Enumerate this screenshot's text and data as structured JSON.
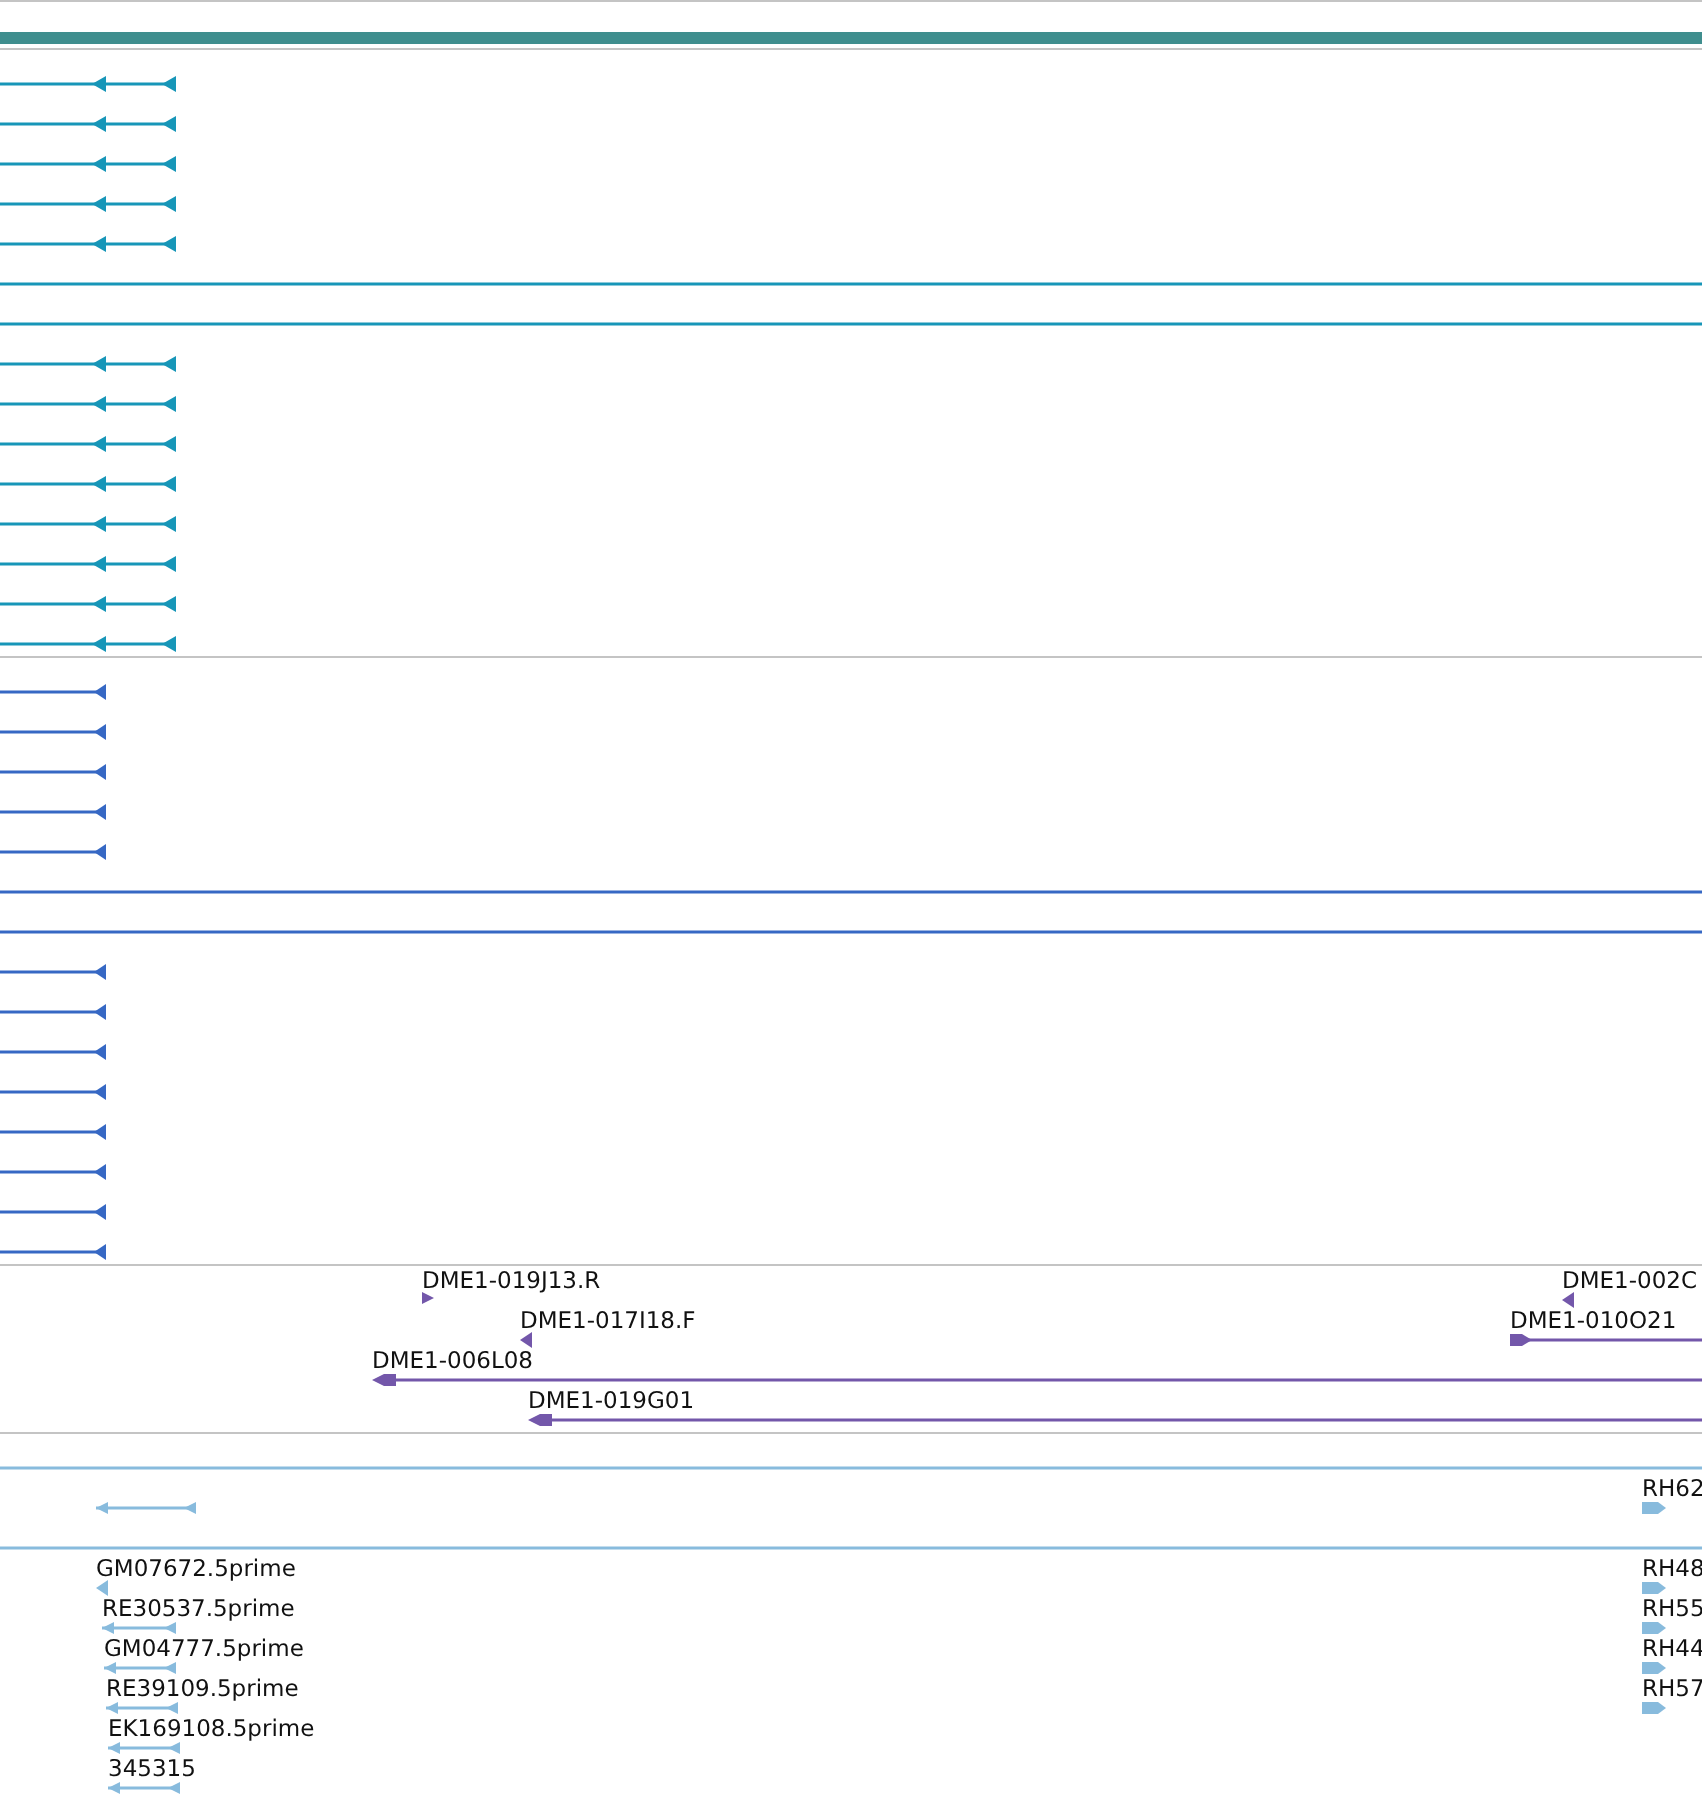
{
  "tracks": [
    {
      "color": "#1796b8",
      "rows": [
        {
          "features": [
            {
              "kind": "paired"
            }
          ]
        },
        {
          "features": [
            {
              "kind": "paired"
            }
          ]
        },
        {
          "features": [
            {
              "kind": "paired"
            }
          ]
        },
        {
          "features": [
            {
              "kind": "paired"
            }
          ]
        },
        {
          "features": [
            {
              "kind": "paired"
            }
          ]
        },
        {
          "features": [
            {
              "kind": "line"
            }
          ]
        },
        {
          "features": [
            {
              "kind": "line"
            }
          ]
        },
        {
          "features": [
            {
              "kind": "paired"
            }
          ]
        },
        {
          "features": [
            {
              "kind": "paired"
            }
          ]
        },
        {
          "features": [
            {
              "kind": "paired"
            }
          ]
        },
        {
          "features": [
            {
              "kind": "paired"
            }
          ]
        },
        {
          "features": [
            {
              "kind": "paired"
            }
          ]
        },
        {
          "features": [
            {
              "kind": "paired"
            }
          ]
        },
        {
          "features": [
            {
              "kind": "paired"
            }
          ]
        },
        {
          "features": [
            {
              "kind": "paired"
            }
          ]
        }
      ]
    },
    {
      "color": "#3668c4",
      "rows": [
        {
          "features": [
            {
              "kind": "single"
            }
          ]
        },
        {
          "features": [
            {
              "kind": "single"
            }
          ]
        },
        {
          "features": [
            {
              "kind": "single"
            }
          ]
        },
        {
          "features": [
            {
              "kind": "single"
            }
          ]
        },
        {
          "features": [
            {
              "kind": "single"
            }
          ]
        },
        {
          "features": [
            {
              "kind": "line"
            }
          ]
        },
        {
          "features": [
            {
              "kind": "line"
            }
          ]
        },
        {
          "features": [
            {
              "kind": "single"
            }
          ]
        },
        {
          "features": [
            {
              "kind": "single"
            }
          ]
        },
        {
          "features": [
            {
              "kind": "single"
            }
          ]
        },
        {
          "features": [
            {
              "kind": "single"
            }
          ]
        },
        {
          "features": [
            {
              "kind": "single"
            }
          ]
        },
        {
          "features": [
            {
              "kind": "single"
            }
          ]
        },
        {
          "features": [
            {
              "kind": "single"
            }
          ]
        },
        {
          "features": [
            {
              "kind": "single"
            }
          ]
        }
      ]
    },
    {
      "color": "#7357aa",
      "rows": [
        {
          "features": [
            {
              "label": "DME1-019J13.R",
              "kind": "tickright"
            },
            {
              "label": "DME1-002C",
              "kind": "tickleft"
            }
          ]
        },
        {
          "features": [
            {
              "label": "DME1-017I18.F",
              "kind": "tickleft"
            },
            {
              "label": "DME1-010O21",
              "kind": "longright"
            }
          ]
        },
        {
          "features": [
            {
              "label": "DME1-006L08",
              "kind": "longleft"
            }
          ]
        },
        {
          "features": [
            {
              "label": "DME1-019G01",
              "kind": "longleft"
            }
          ]
        }
      ]
    },
    {
      "color": "#88bbdd",
      "rows": [
        {
          "features": [
            {
              "kind": "line"
            }
          ]
        },
        {
          "features": [
            {
              "kind": "span"
            },
            {
              "label": "RH62",
              "kind": "block"
            }
          ]
        },
        {
          "features": [
            {
              "kind": "line"
            }
          ]
        },
        {
          "features": [
            {
              "label": "GM07672.5prime",
              "kind": "tickleft"
            },
            {
              "label": "RH48",
              "kind": "block"
            }
          ]
        },
        {
          "features": [
            {
              "label": "RE30537.5prime",
              "kind": "span"
            },
            {
              "label": "RH55",
              "kind": "block"
            }
          ]
        },
        {
          "features": [
            {
              "label": "GM04777.5prime",
              "kind": "span"
            },
            {
              "label": "RH44",
              "kind": "block"
            }
          ]
        },
        {
          "features": [
            {
              "label": "RE39109.5prime",
              "kind": "span"
            },
            {
              "label": "RH57",
              "kind": "block"
            }
          ]
        },
        {
          "features": [
            {
              "label": "EK169108.5prime",
              "kind": "span"
            }
          ]
        },
        {
          "features": [
            {
              "label": "345315",
              "kind": "span"
            }
          ]
        }
      ]
    }
  ]
}
